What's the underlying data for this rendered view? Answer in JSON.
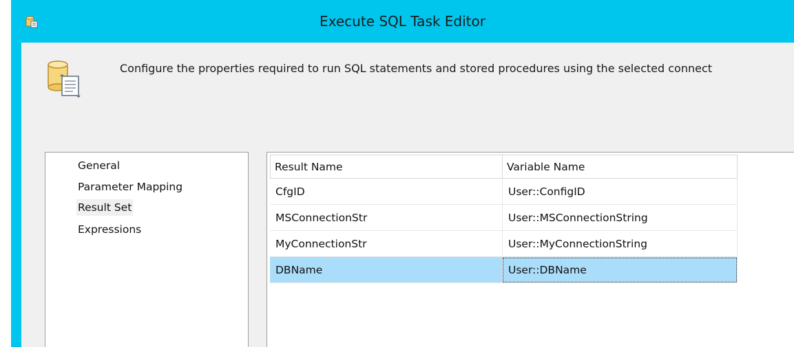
{
  "window": {
    "title": "Execute SQL Task Editor",
    "title_icon": "sql-task-icon"
  },
  "header": {
    "icon": "database-scroll-icon",
    "description": "Configure the properties required to run SQL statements and stored procedures using the selected connect"
  },
  "nav": {
    "items": [
      {
        "label": "General",
        "selected": false
      },
      {
        "label": "Parameter Mapping",
        "selected": false
      },
      {
        "label": "Result Set",
        "selected": true
      },
      {
        "label": "Expressions",
        "selected": false
      }
    ]
  },
  "result_set": {
    "columns": [
      "Result Name",
      "Variable Name"
    ],
    "rows": [
      {
        "result_name": "CfgID",
        "variable_name": "User::ConfigID",
        "selected": false
      },
      {
        "result_name": "MSConnectionStr",
        "variable_name": "User::MSConnectionString",
        "selected": false
      },
      {
        "result_name": "MyConnectionStr",
        "variable_name": "User::MyConnectionString",
        "selected": false
      },
      {
        "result_name": "DBName",
        "variable_name": "User::DBName",
        "selected": true
      }
    ]
  },
  "colors": {
    "titlebar": "#00c6ee",
    "client_bg": "#f0f0f0",
    "selected_row": "#aaddfa"
  }
}
